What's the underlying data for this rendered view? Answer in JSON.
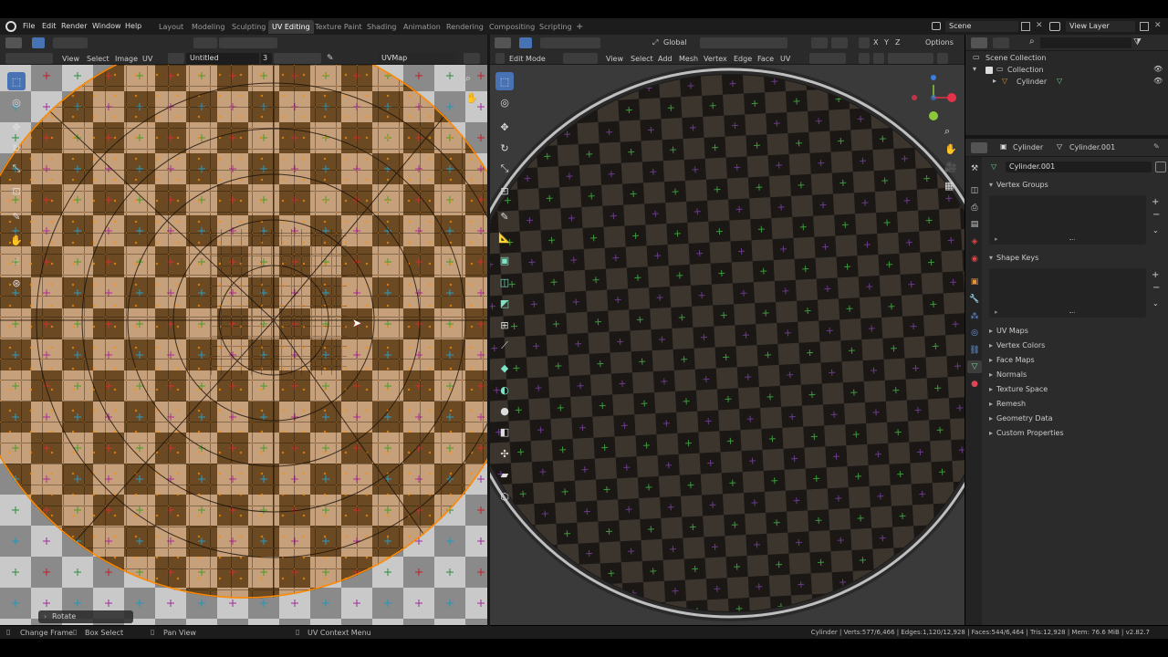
{
  "menu": [
    "File",
    "Edit",
    "Render",
    "Window",
    "Help"
  ],
  "workspaces": [
    "Layout",
    "Modeling",
    "Sculpting",
    "UV Editing",
    "Texture Paint",
    "Shading",
    "Animation",
    "Rendering",
    "Compositing",
    "Scripting"
  ],
  "workspace_active_index": 3,
  "add_tab": "+",
  "scene": {
    "label": "Scene"
  },
  "view_layer": {
    "label": "View Layer"
  },
  "uv_editor": {
    "menus": [
      "View",
      "Select",
      "Image",
      "UV"
    ],
    "image_name": "Untitled",
    "users": "3",
    "uvmap": "UVMap",
    "operator_panel": "Rotate"
  },
  "viewport": {
    "mode": "Edit Mode",
    "menus": [
      "View",
      "Select",
      "Add",
      "Mesh",
      "Vertex",
      "Edge",
      "Face",
      "UV"
    ],
    "transform_orientation": "Global",
    "axes": [
      "X",
      "Y",
      "Z"
    ],
    "options_label": "Options",
    "gizmo_colors": {
      "x": "#e4324a",
      "y": "#8bc93b",
      "z": "#3a7ee0"
    }
  },
  "outliner": {
    "search_placeholder": "",
    "items": [
      {
        "label": "Scene Collection"
      },
      {
        "label": "Collection"
      },
      {
        "label": "Cylinder"
      }
    ]
  },
  "properties": {
    "object_name": "Cylinder",
    "mesh_name": "Cylinder.001",
    "datablock": "Cylinder.001",
    "panels_open": [
      "Vertex Groups",
      "Shape Keys"
    ],
    "panels_closed": [
      "UV Maps",
      "Vertex Colors",
      "Face Maps",
      "Normals",
      "Texture Space",
      "Remesh",
      "Geometry Data",
      "Custom Properties"
    ]
  },
  "statusbar": {
    "hints": [
      "Change Frame",
      "Box Select",
      "Pan View",
      "UV Context Menu"
    ],
    "stats": "Cylinder | Verts:577/6,466 | Edges:1,120/12,928 | Faces:544/6,464 | Tris:12,928 | Mem: 76.6 MiB | v2.82.7"
  },
  "colors": {
    "accent": "#4772b3",
    "uv_orange": "#ff8a00",
    "bg": "#303030"
  }
}
